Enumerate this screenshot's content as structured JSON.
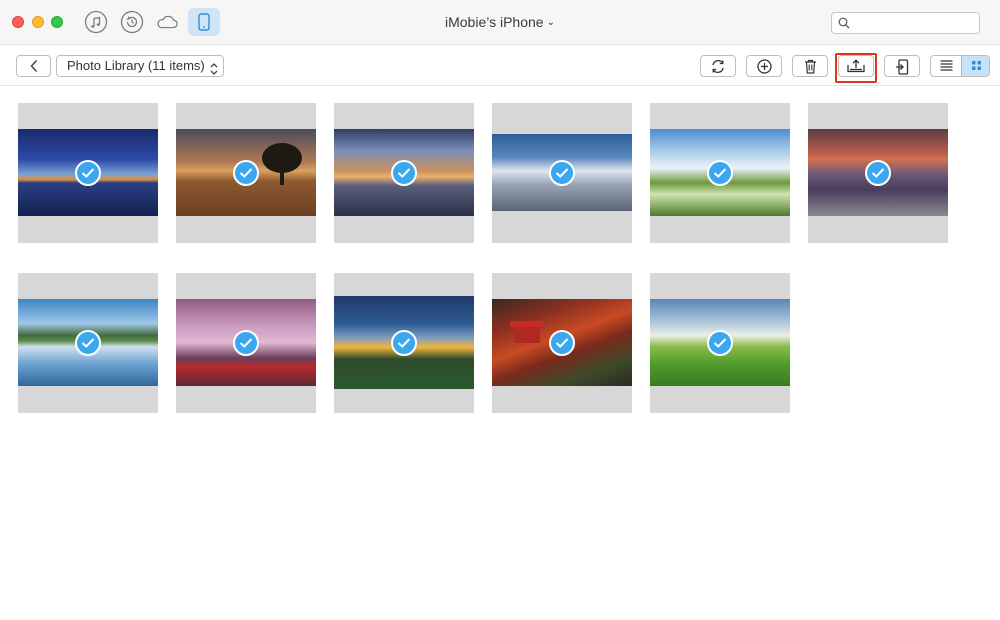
{
  "window": {
    "title": "iMobie’s iPhone",
    "title_chevron": "⌄",
    "search_placeholder": ""
  },
  "titlebar_icons": [
    "music-icon",
    "backup-icon",
    "icloud-icon",
    "device-icon"
  ],
  "toolbar": {
    "library_label": "Photo Library (11 items)",
    "buttons": [
      "back-icon",
      "refresh-icon",
      "add-icon",
      "trash-icon",
      "export-to-computer-icon",
      "send-to-device-icon",
      "list-view-icon",
      "grid-view-icon"
    ]
  },
  "colors": {
    "accent": "#3aa7ef",
    "highlight_box": "#e0341f",
    "device_button_bg": "#cfe5f7",
    "tile_bg": "#d7d7d7"
  },
  "photos": [
    {
      "subject": "night lake with blue sky",
      "selected": true
    },
    {
      "subject": "tree on plowed field at sunset",
      "selected": true
    },
    {
      "subject": "cloudy sunset over water",
      "selected": true
    },
    {
      "subject": "snowy mountain peaks",
      "selected": true
    },
    {
      "subject": "flower field under blue sky",
      "selected": true
    },
    {
      "subject": "mountain lake with rocks at dusk",
      "selected": true
    },
    {
      "subject": "mountains reflected in lake",
      "selected": true
    },
    {
      "subject": "cherry blossoms and red bridge",
      "selected": true
    },
    {
      "subject": "sunset over green hills",
      "selected": true
    },
    {
      "subject": "red pagoda in autumn forest",
      "selected": true
    },
    {
      "subject": "green meadow with sun rays",
      "selected": true
    }
  ]
}
